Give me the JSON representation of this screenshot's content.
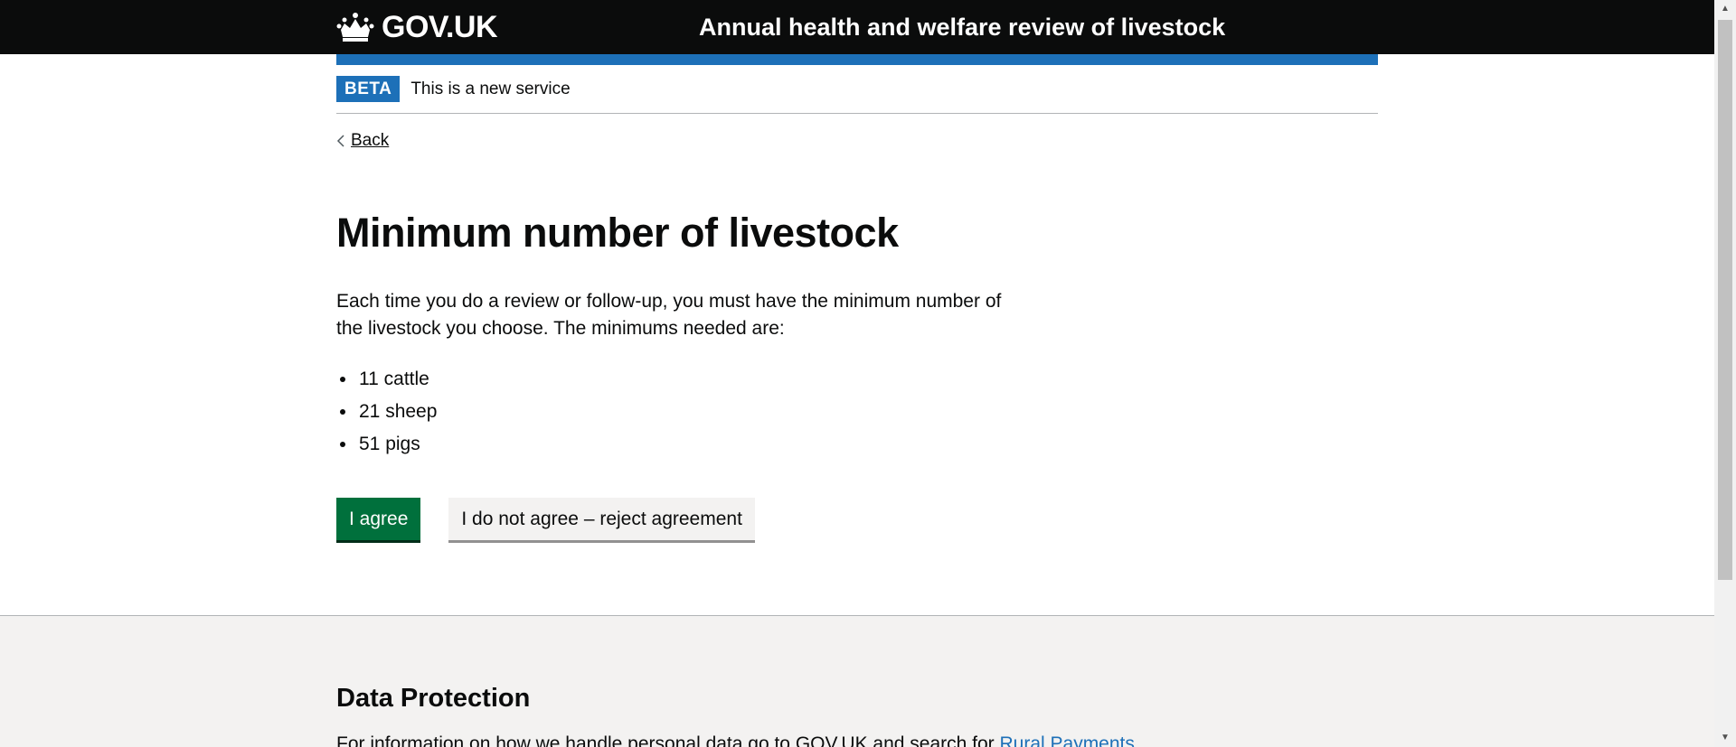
{
  "header": {
    "logo_text": "GOV.UK",
    "service_name": "Annual health and welfare review of livestock"
  },
  "phase_banner": {
    "tag": "BETA",
    "text": "This is a new service"
  },
  "back_link": "Back",
  "main": {
    "heading": "Minimum number of livestock",
    "intro": "Each time you do a review or follow-up, you must have the minimum number of the livestock you choose. The minimums needed are:",
    "minimums": [
      "11 cattle",
      "21 sheep",
      "51 pigs"
    ],
    "agree_button": "I agree",
    "reject_button": "I do not agree – reject agreement"
  },
  "footer": {
    "heading": "Data Protection",
    "text": "For information on how we handle personal data go to GOV.UK and search for ",
    "link_text": "Rural Payments"
  },
  "colors": {
    "header_bg": "#0b0c0c",
    "accent_blue": "#1d70b8",
    "primary_green": "#00703c",
    "footer_bg": "#f3f2f1"
  }
}
